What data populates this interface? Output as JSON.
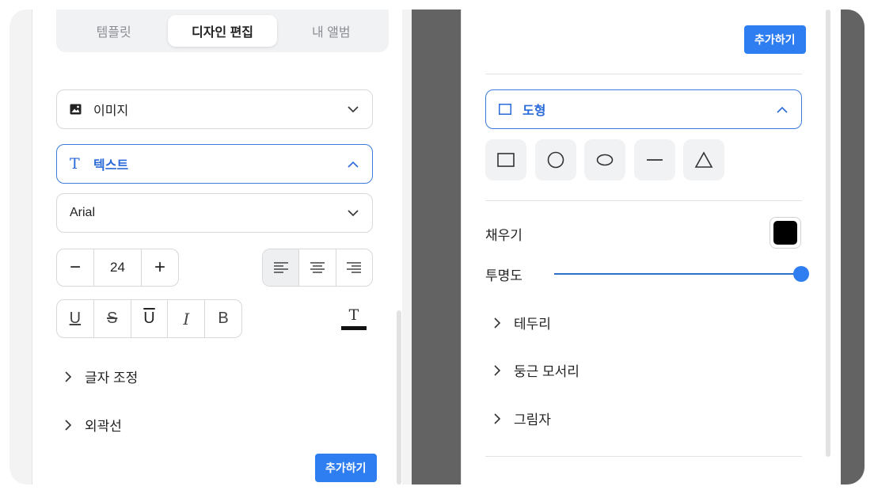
{
  "left_panel": {
    "tabs": [
      {
        "label": "템플릿",
        "active": false
      },
      {
        "label": "디자인 편집",
        "active": true
      },
      {
        "label": "내 앨범",
        "active": false
      }
    ],
    "image_section": {
      "label": "이미지",
      "icon": "image-icon",
      "expanded": false
    },
    "text_section": {
      "label": "텍스트",
      "icon": "text-T-icon",
      "expanded": true
    },
    "font_select": {
      "value": "Arial"
    },
    "font_size": {
      "value": "24",
      "decrement": "−",
      "increment": "+"
    },
    "alignment": {
      "options": [
        "align-left",
        "align-center",
        "align-right"
      ],
      "selected": "align-left"
    },
    "formatting": [
      {
        "name": "underline",
        "glyph": "U"
      },
      {
        "name": "strikethrough",
        "glyph": "S"
      },
      {
        "name": "overline",
        "glyph": "U"
      },
      {
        "name": "italic",
        "glyph": "I"
      },
      {
        "name": "bold",
        "glyph": "B"
      }
    ],
    "text_color": {
      "glyph": "T",
      "color": "#111111"
    },
    "collapsibles": [
      {
        "label": "글자 조정"
      },
      {
        "label": "외곽선"
      }
    ],
    "add_button": "추가하기"
  },
  "right_panel": {
    "add_button_top": "추가하기",
    "shape_section": {
      "label": "도형",
      "icon": "square-icon",
      "expanded": true
    },
    "shapes": [
      "rectangle",
      "circle",
      "ellipse",
      "line",
      "triangle"
    ],
    "fill": {
      "label": "채우기",
      "color": "#000000"
    },
    "opacity": {
      "label": "투명도",
      "value": 1.0
    },
    "collapsibles": [
      {
        "label": "테두리"
      },
      {
        "label": "둥근 모서리"
      },
      {
        "label": "그림자"
      }
    ]
  },
  "colors": {
    "accent": "#2e7ef1",
    "active_text": "#2a6ad9",
    "backdrop": "#636363"
  }
}
